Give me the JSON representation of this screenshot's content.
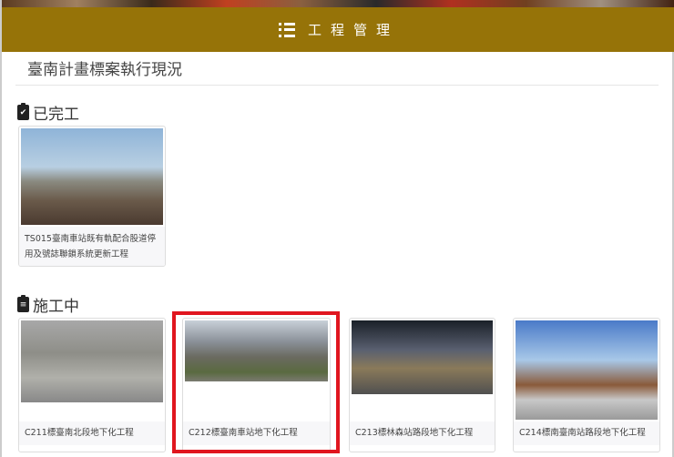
{
  "header": {
    "title": "工程管理",
    "icon": "list-icon",
    "color": "#967308"
  },
  "page_title": "臺南計畫標案執行現況",
  "sections": [
    {
      "title": "已完工",
      "icon": "clipboard-check-icon",
      "cards": [
        {
          "title": "TS015臺南車站既有軌配合股道停用及號誌聯鎖系統更新工程"
        }
      ]
    },
    {
      "title": "施工中",
      "icon": "clipboard-list-icon",
      "cards": [
        {
          "title": "C211標臺南北段地下化工程"
        },
        {
          "title": "C212標臺南車站地下化工程"
        },
        {
          "title": "C213標林森站路段地下化工程"
        },
        {
          "title": "C214標南臺南站路段地下化工程"
        }
      ]
    }
  ],
  "highlight_color": "#e0161f"
}
